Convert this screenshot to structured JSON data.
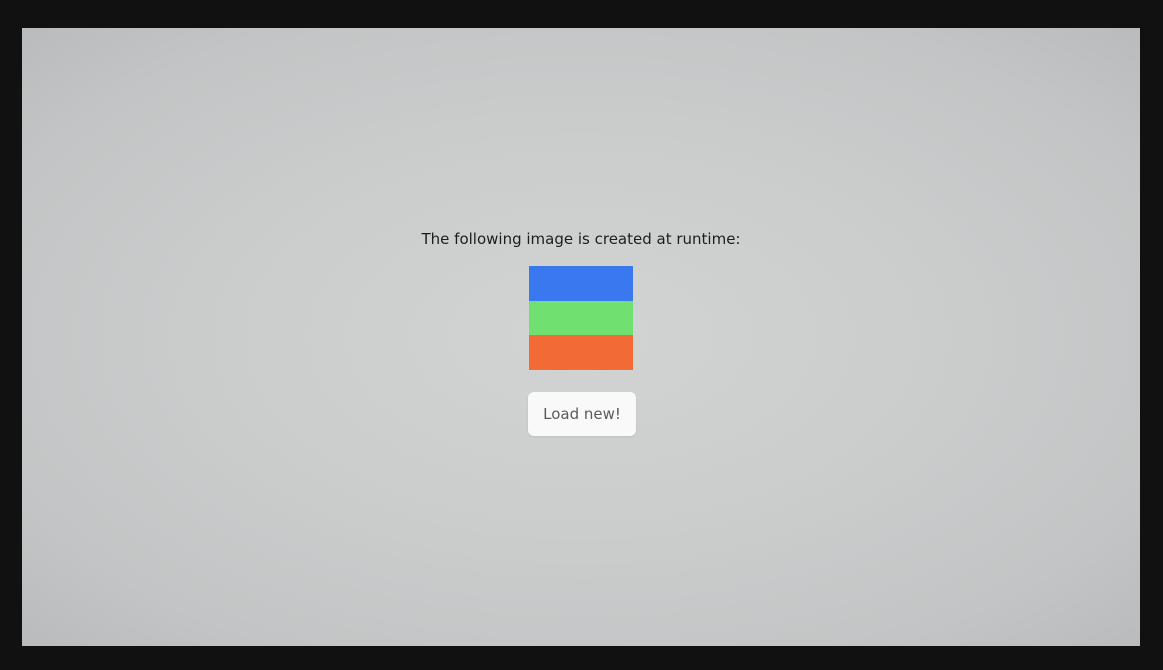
{
  "caption": "The following image is created at runtime:",
  "runtime_image": {
    "stripes": [
      {
        "name": "blue-stripe",
        "color": "#3a78f0"
      },
      {
        "name": "green-stripe",
        "color": "#70e070"
      },
      {
        "name": "orange-stripe",
        "color": "#f26a35"
      }
    ]
  },
  "button": {
    "label": "Load new!"
  }
}
